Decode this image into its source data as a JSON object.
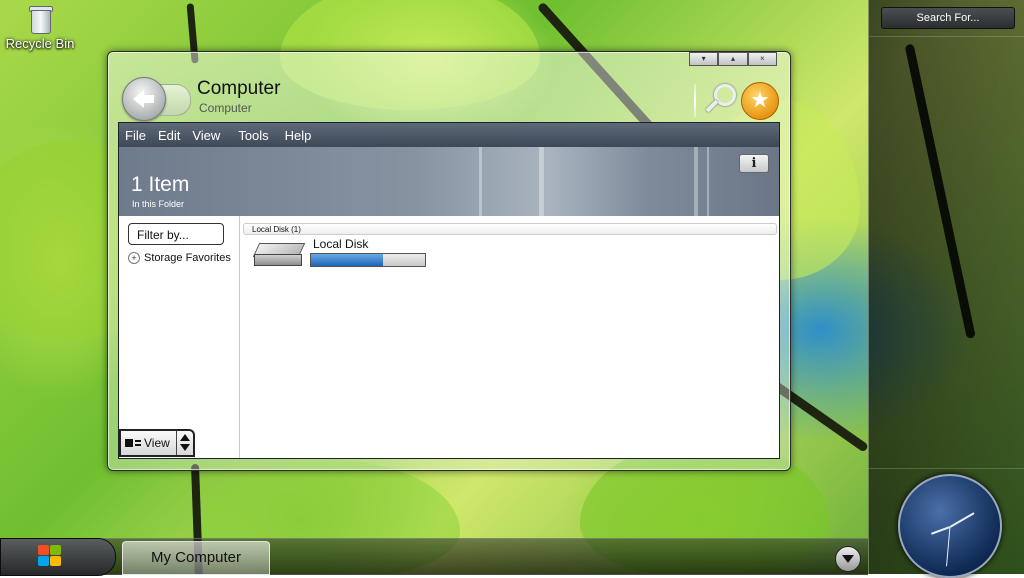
{
  "desktop": {
    "icons": [
      {
        "label": "Recycle Bin",
        "icon": "recycle-bin-icon"
      }
    ]
  },
  "sidebar": {
    "search_label": "Search For..."
  },
  "taskbar": {
    "start_icon": "windows-flag-icon",
    "task_button_label": "My Computer",
    "tray_arrow_icon": "chevron-down-icon"
  },
  "window": {
    "title": "Computer",
    "subtitle": "Computer",
    "caption_buttons": [
      "▾",
      "▴",
      "×"
    ],
    "menu": [
      "File",
      "Edit",
      "View",
      "Tools",
      "Help"
    ],
    "banner": {
      "count": "1 Item",
      "sub": "In this Folder",
      "info_label": "i"
    },
    "left_pane": {
      "filter_label": "Filter by...",
      "tree_items": [
        {
          "label": "Storage Favorites",
          "expander": "+"
        }
      ],
      "view_label": "View"
    },
    "groups": [
      {
        "header": "Local Disk (1)",
        "items": [
          {
            "name": "Local Disk",
            "icon": "hard-drive-icon",
            "usage_fraction": 0.63
          }
        ]
      }
    ],
    "accent_color": "#1d64b8"
  }
}
